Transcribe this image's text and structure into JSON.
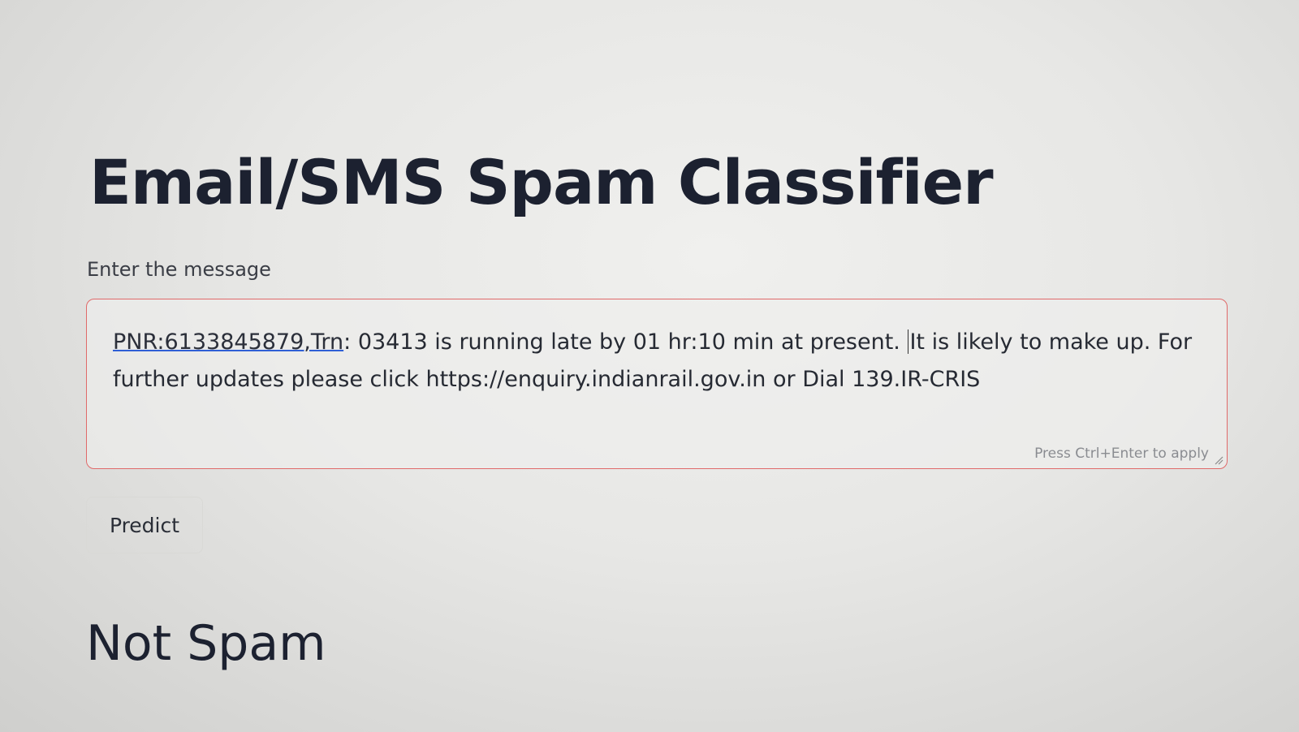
{
  "app": {
    "title": "Email/SMS Spam Classifier"
  },
  "input": {
    "label": "Enter the message",
    "value_pnr": "PNR:6133845879,Trn",
    "value_part1": ": 03413 is running late by 01 hr:10 min at present. ",
    "value_part2": "It is likely to make up. For further updates please click https://enquiry.indianrail.gov.in or Dial 139.IR-CRIS",
    "hint": "Press Ctrl+Enter to apply",
    "border_color": "#e06a6a"
  },
  "actions": {
    "predict_label": "Predict"
  },
  "result": {
    "text": "Not Spam"
  }
}
